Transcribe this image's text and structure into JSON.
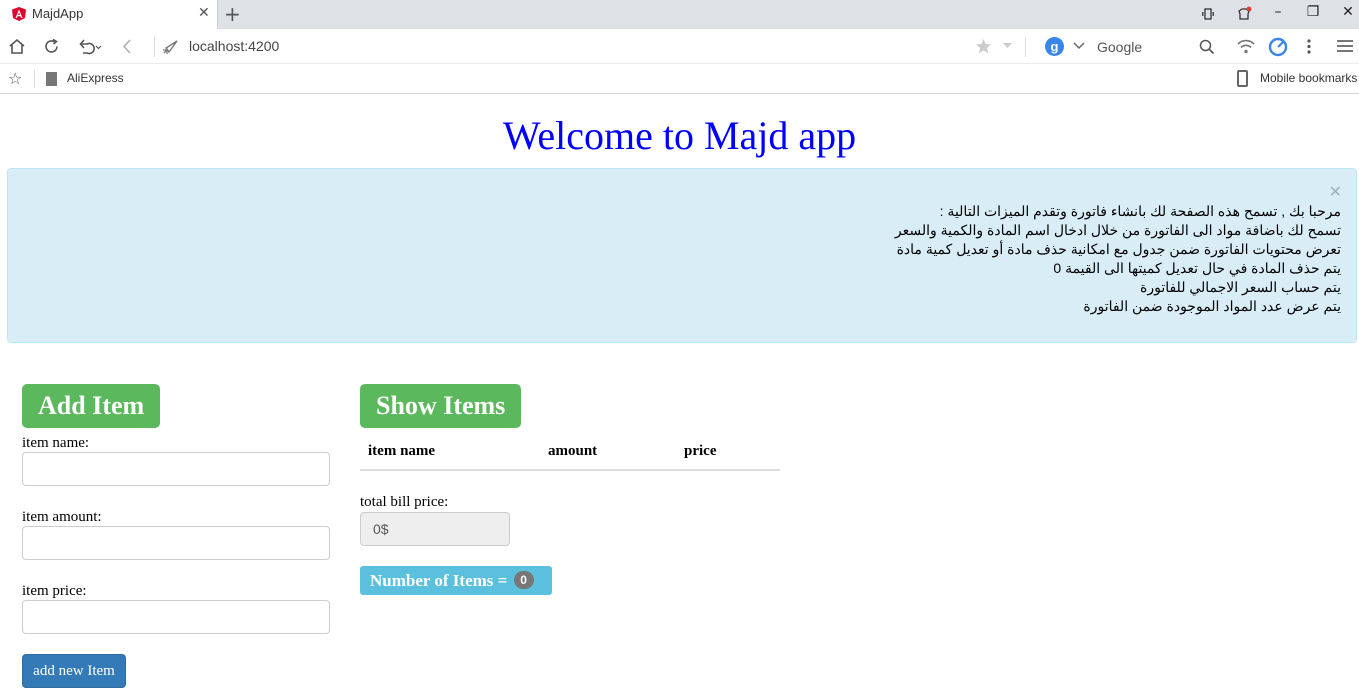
{
  "browser": {
    "tab_title": "MajdApp",
    "url": "localhost:4200",
    "search_engine_badge": "g",
    "search_placeholder": "Google",
    "bookmarks": [
      "AliExpress"
    ],
    "mobile_bookmarks": "Mobile bookmarks"
  },
  "page": {
    "title": "Welcome to Majd app",
    "alert_lines": [
      "مرحبا بك , تسمح هذه الصفحة لك بانشاء فاتورة وتقدم الميزات التالية :",
      "تسمح لك باضافة مواد الى الفاتورة من خلال ادخال اسم المادة والكمية والسعر",
      "تعرض محتويات الفاتورة ضمن جدول مع امكانية حذف مادة أو تعديل كمية مادة",
      "يتم حذف المادة في حال تعديل كميتها الى القيمة 0",
      "يتم حساب السعر الاجمالي للفاتورة",
      "يتم عرض عدد المواد الموجودة ضمن الفاتورة"
    ]
  },
  "add_item": {
    "heading": "Add Item",
    "name_label": "item name:",
    "amount_label": "item amount:",
    "price_label": "item price:",
    "submit_label": "add new Item"
  },
  "show_items": {
    "heading": "Show Items",
    "columns": [
      "item name",
      "amount",
      "price"
    ],
    "total_label": "total bill price:",
    "total_value": "0$",
    "count_label": "Number of Items =",
    "count_value": "0"
  },
  "colors": {
    "title": "#0000ff",
    "alert_bg": "#d9edf7",
    "success": "#5cb85c",
    "primary": "#337ab7",
    "info": "#5bc0de"
  },
  "icons": {
    "tab": "angular-logo-icon",
    "nav": [
      "home-icon",
      "reload-icon",
      "undo-icon",
      "back-icon",
      "rocket-icon"
    ],
    "toolbar": [
      "star-icon",
      "search-icon",
      "wifi-icon",
      "speed-dial-icon",
      "menu-icon"
    ]
  }
}
